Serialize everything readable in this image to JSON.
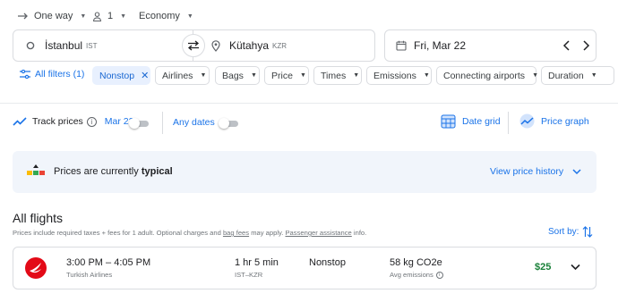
{
  "trip_options": {
    "trip_type": "One way",
    "passengers": "1",
    "cabin_class": "Economy"
  },
  "search": {
    "origin": {
      "city": "İstanbul",
      "code": "IST"
    },
    "destination": {
      "city": "Kütahya",
      "code": "KZR"
    },
    "date": "Fri, Mar 22"
  },
  "filters": {
    "all_filters_label": "All filters (1)",
    "chips": [
      {
        "label": "Nonstop",
        "active": true
      },
      {
        "label": "Airlines"
      },
      {
        "label": "Bags"
      },
      {
        "label": "Price"
      },
      {
        "label": "Times"
      },
      {
        "label": "Emissions"
      },
      {
        "label": "Connecting airports"
      },
      {
        "label": "Duration"
      }
    ]
  },
  "tracking": {
    "track_prices_label": "Track prices",
    "track_date": "Mar 22",
    "any_dates_label": "Any dates",
    "date_grid_label": "Date grid",
    "price_graph_label": "Price graph"
  },
  "price_insight": {
    "text_prefix": "Prices are currently",
    "level": "typical",
    "history_link": "View price history"
  },
  "results": {
    "heading": "All flights",
    "disclaimer_before": "Prices include required taxes + fees for 1 adult. Optional charges and",
    "bag_fees_link": "bag fees",
    "disclaimer_middle": "may apply.",
    "assistance_link": "Passenger assistance",
    "disclaimer_after": "info.",
    "sort_label": "Sort by:",
    "flights": [
      {
        "times": "3:00 PM – 4:05 PM",
        "airline": "Turkish Airlines",
        "duration": "1 hr 5 min",
        "route": "IST–KZR",
        "stops": "Nonstop",
        "emissions": "58 kg CO2e",
        "emissions_label": "Avg emissions",
        "price": "$25"
      }
    ]
  },
  "colors": {
    "accent": "#1a73e8",
    "price_green": "#188038",
    "chip_active_bg": "#e8f0fe",
    "banner_bg": "#f1f5fb",
    "airline_red": "#e30a17"
  }
}
